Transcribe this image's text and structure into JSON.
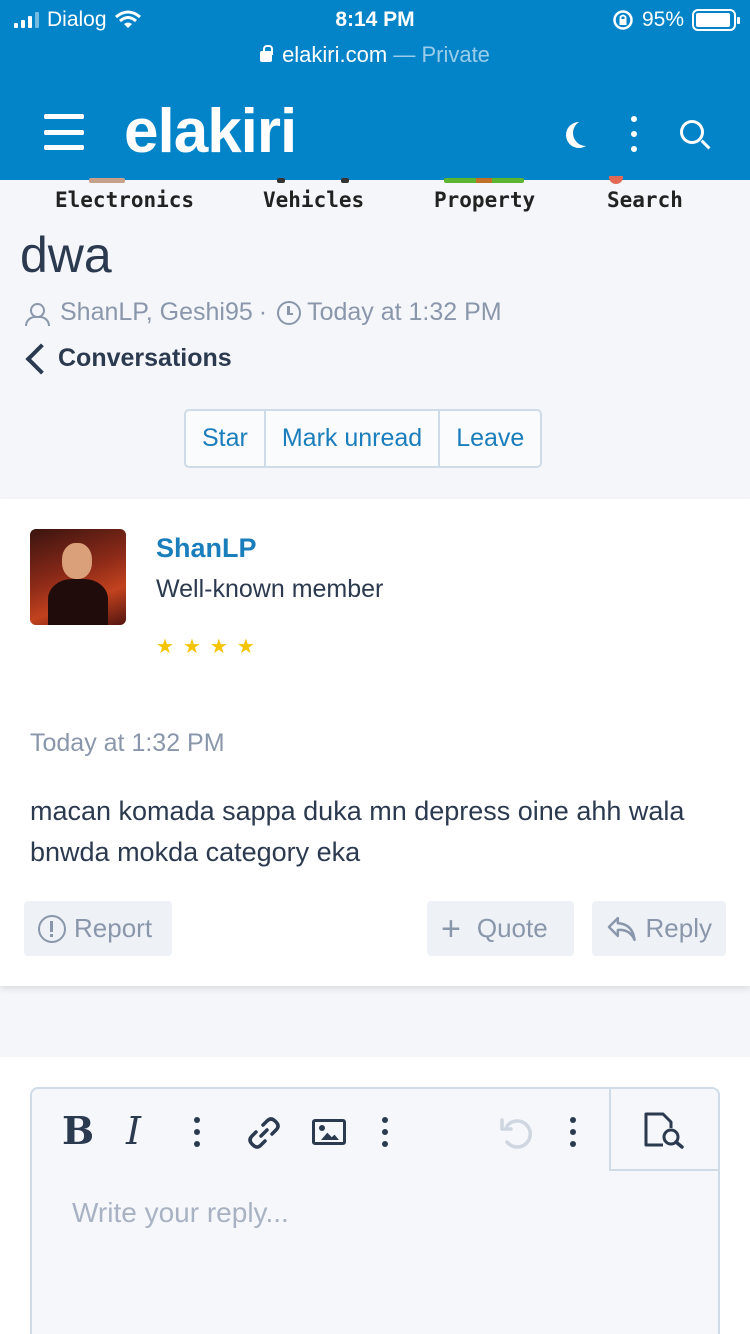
{
  "status_bar": {
    "carrier": "Dialog",
    "time": "8:14 PM",
    "battery": "95%",
    "battery_level": 0.95
  },
  "url_bar": {
    "domain": "elakiri.com",
    "mode": "— Private"
  },
  "header": {
    "logo": "elakiri",
    "brand_color": "#0383c8"
  },
  "categories": [
    "Electronics",
    "Vehicles",
    "Property",
    "Search"
  ],
  "conversation": {
    "title": "dwa",
    "participants": "ShanLP, Geshi95",
    "separator": "·",
    "time": "Today at 1:32 PM",
    "back_label": "Conversations"
  },
  "actions": {
    "star": "Star",
    "mark_unread": "Mark unread",
    "leave": "Leave"
  },
  "message": {
    "username": "ShanLP",
    "user_title": "Well-known member",
    "rating_stars": 4,
    "date": "Today at 1:32 PM",
    "body": "macan komada sappa duka mn depress oine ahh wala bnwda mokda category eka",
    "report_label": "Report",
    "quote_label": "Quote",
    "reply_label": "Reply"
  },
  "editor": {
    "placeholder": "Write your reply...",
    "bold": "B",
    "italic": "I"
  },
  "icons": {
    "menu": "hamburger-icon",
    "theme": "moon-icon",
    "more": "more-vertical-icon",
    "search": "search-icon",
    "link": "link-icon",
    "image": "image-icon",
    "undo": "undo-icon",
    "preview": "preview-icon"
  }
}
